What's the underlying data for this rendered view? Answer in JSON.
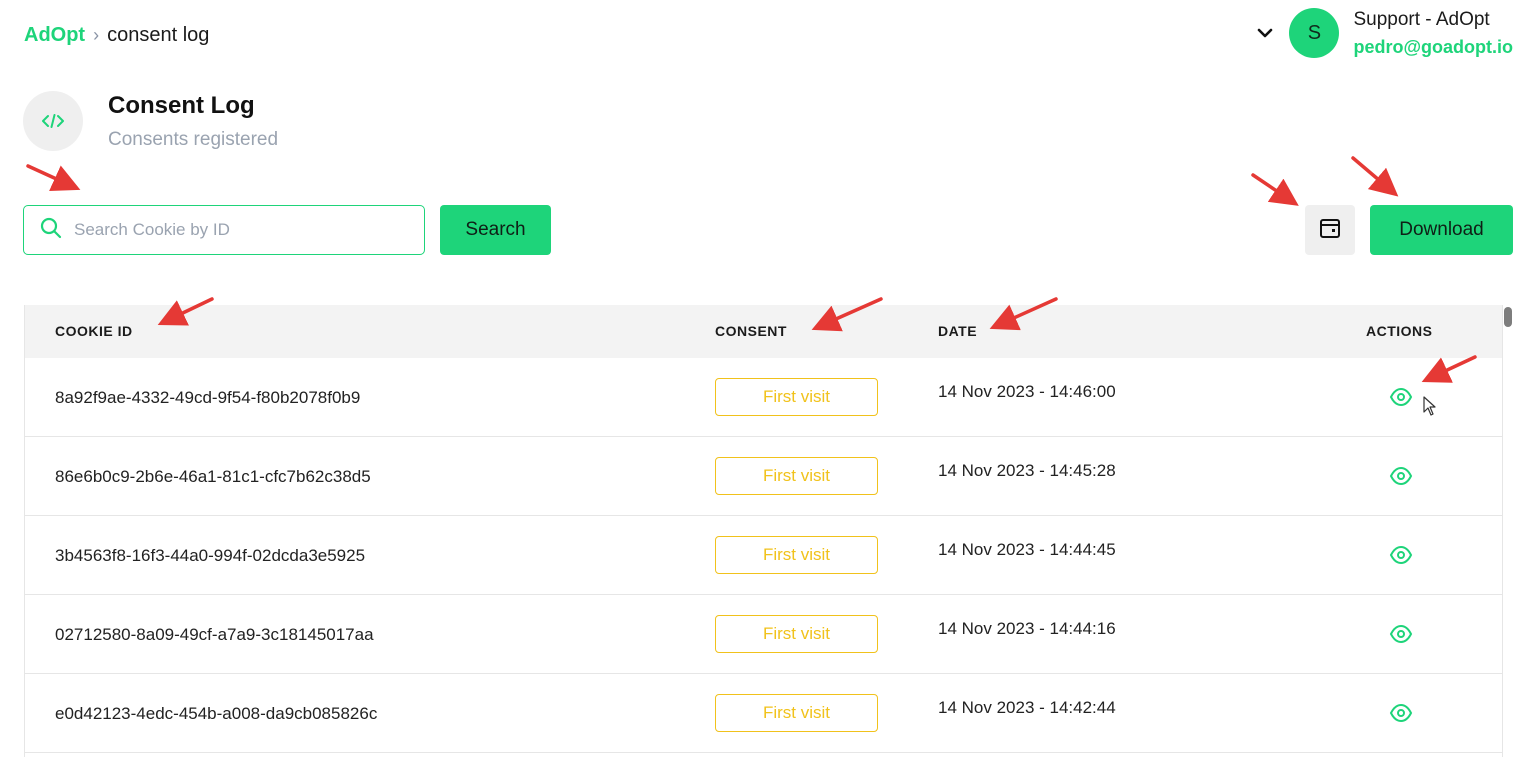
{
  "breadcrumb": {
    "root": "AdOpt",
    "separator": "›",
    "current": "consent log"
  },
  "user": {
    "avatar_initial": "S",
    "name": "Support - AdOpt",
    "email": "pedro@goadopt.io"
  },
  "page": {
    "title": "Consent Log",
    "subtitle": "Consents registered"
  },
  "toolbar": {
    "search_placeholder": "Search Cookie by ID",
    "search_label": "Search",
    "download_label": "Download"
  },
  "table": {
    "headers": {
      "cookie_id": "COOKIE ID",
      "consent": "CONSENT",
      "date": "DATE",
      "actions": "ACTIONS"
    },
    "rows": [
      {
        "cookie_id": "8a92f9ae-4332-49cd-9f54-f80b2078f0b9",
        "consent": "First visit",
        "date": "14 Nov 2023 - 14:46:00"
      },
      {
        "cookie_id": "86e6b0c9-2b6e-46a1-81c1-cfc7b62c38d5",
        "consent": "First visit",
        "date": "14 Nov 2023 - 14:45:28"
      },
      {
        "cookie_id": "3b4563f8-16f3-44a0-994f-02dcda3e5925",
        "consent": "First visit",
        "date": "14 Nov 2023 - 14:44:45"
      },
      {
        "cookie_id": "02712580-8a09-49cf-a7a9-3c18145017aa",
        "consent": "First visit",
        "date": "14 Nov 2023 - 14:44:16"
      },
      {
        "cookie_id": "e0d42123-4edc-454b-a008-da9cb085826c",
        "consent": "First visit",
        "date": "14 Nov 2023 - 14:42:44"
      }
    ]
  },
  "colors": {
    "brand": "#1ed47a",
    "badge": "#f1c21b",
    "annotation": "#e53935"
  },
  "icons": {
    "chevron": "chevron-down-icon",
    "code": "code-icon",
    "search": "search-icon",
    "calendar": "calendar-icon",
    "view": "eye-icon"
  }
}
